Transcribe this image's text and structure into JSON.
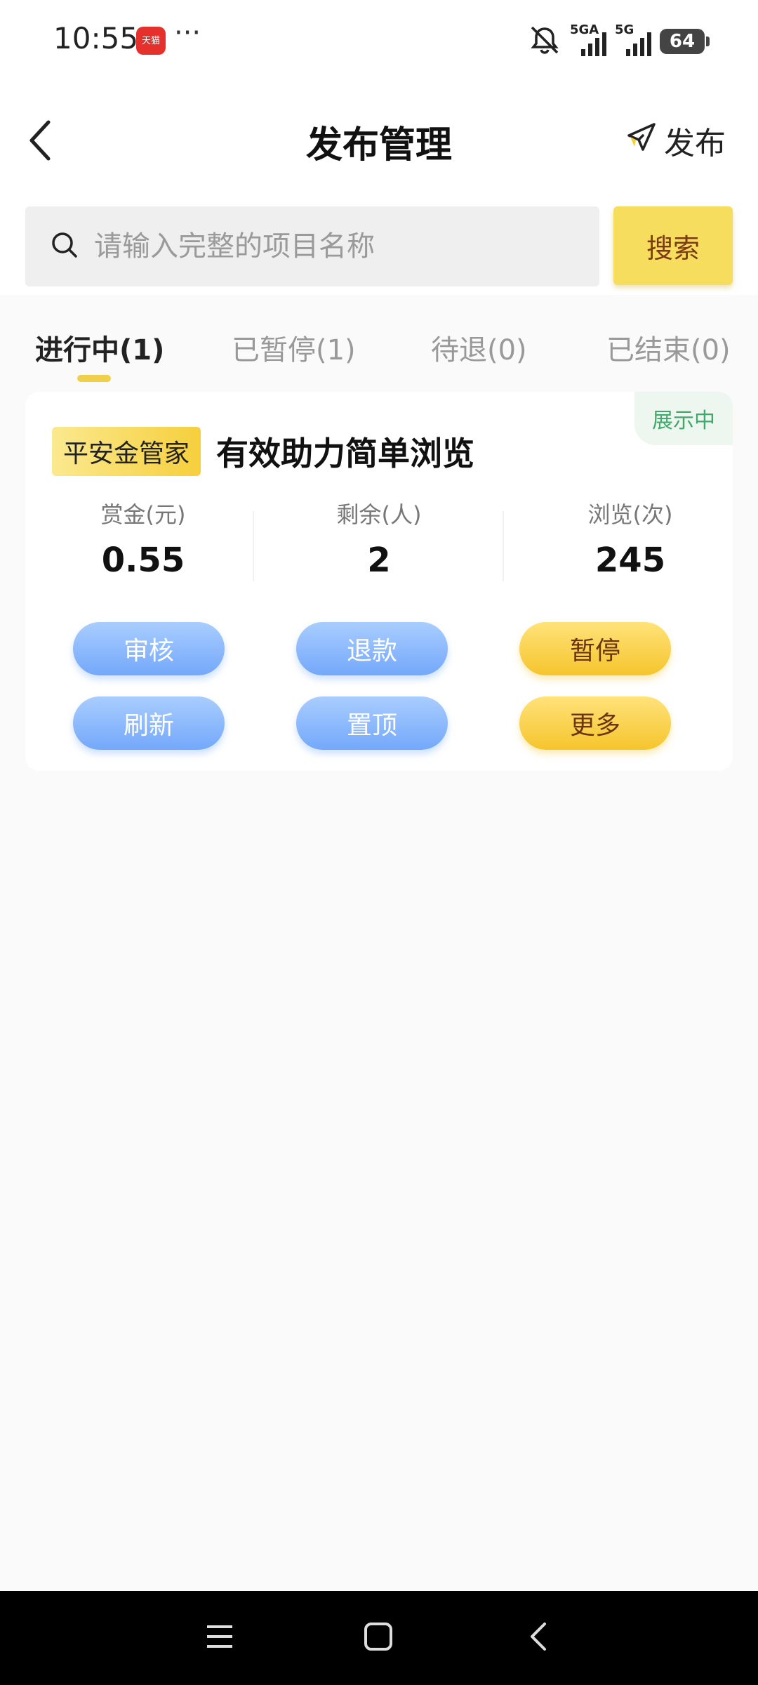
{
  "status_bar": {
    "time": "10:55",
    "app_badge_text": "天猫",
    "overflow": "···",
    "network1": "5GA",
    "network2": "5G",
    "battery": "64",
    "icons": [
      "mute-bell-icon",
      "signal-icon",
      "signal-icon",
      "battery-icon"
    ]
  },
  "header": {
    "title": "发布管理",
    "publish_label": "发布",
    "icons": [
      "back-chevron-icon",
      "paper-plane-icon"
    ]
  },
  "search": {
    "placeholder": "请输入完整的项目名称",
    "value": "",
    "button_label": "搜索"
  },
  "tabs": [
    {
      "label": "进行中(1)",
      "active": true
    },
    {
      "label": "已暂停(1)",
      "active": false
    },
    {
      "label": "待退(0)",
      "active": false
    },
    {
      "label": "已结束(0)",
      "active": false
    }
  ],
  "card": {
    "status": "展示中",
    "brand": "平安金管家",
    "title": "有效助力简单浏览",
    "stats": [
      {
        "label": "赏金(元)",
        "value": "0.55"
      },
      {
        "label": "剩余(人)",
        "value": "2"
      },
      {
        "label": "浏览(次)",
        "value": "245"
      }
    ],
    "buttons": {
      "review": "审核",
      "refund": "退款",
      "pause": "暂停",
      "refresh": "刷新",
      "pin": "置顶",
      "more": "更多"
    }
  },
  "nav_bar": {
    "icons": [
      "menu-icon",
      "home-square-icon",
      "back-icon"
    ]
  },
  "colors": {
    "accent_yellow": "#f6dd5e",
    "button_blue": "#74a8fa",
    "status_green": "#3fa86a"
  }
}
